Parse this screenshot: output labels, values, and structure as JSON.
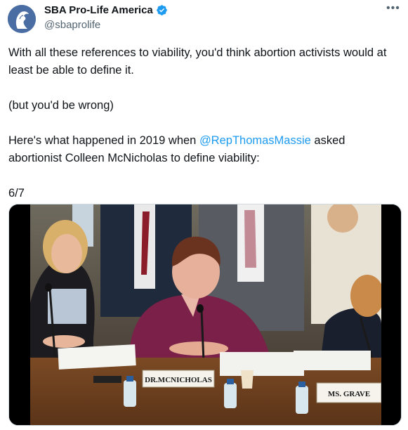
{
  "author": {
    "display_name": "SBA Pro-Life America",
    "handle": "@sbaprolife",
    "verified": true,
    "avatar_icon": "woman-silhouette-logo-icon"
  },
  "more_icon": "more-options-icon",
  "tweet": {
    "line1": "With all these references to viability, you'd think abortion activists would at least be able to define it.",
    "line2": "(but you'd be wrong)",
    "line3_pre": "Here's what happened in 2019 when ",
    "line3_mention": "@RepThomasMassie",
    "line3_post": " asked abortionist Colleen McNicholas to define viability:",
    "line4": "6/7"
  },
  "media": {
    "placard_left": "DR.MCNICHOLAS",
    "placard_right": "MS. GRAVE"
  },
  "colors": {
    "accent": "#1d9bf0",
    "text": "#0f1419",
    "muted": "#536471"
  }
}
